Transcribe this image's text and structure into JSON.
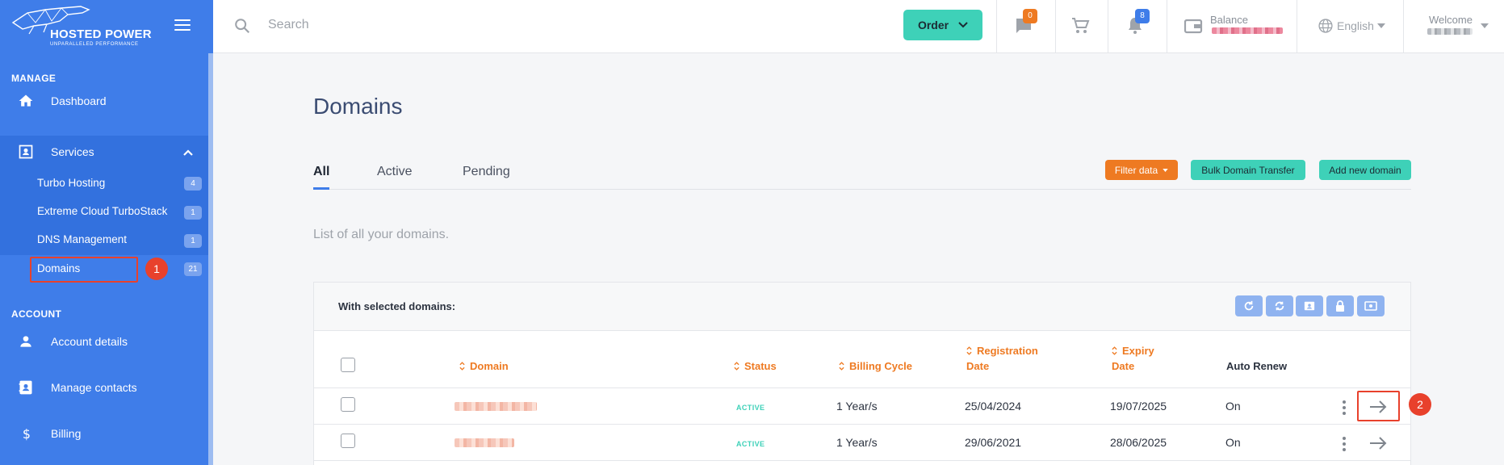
{
  "brand": {
    "name": "HOSTED POWER",
    "tagline": "UNPARALLELED PERFORMANCE"
  },
  "sidebar": {
    "manage_title": "MANAGE",
    "account_title": "ACCOUNT",
    "dashboard": "Dashboard",
    "services": "Services",
    "services_items": [
      {
        "label": "Turbo Hosting",
        "count": "4"
      },
      {
        "label": "Extreme Cloud TurboStack",
        "count": "1"
      },
      {
        "label": "DNS Management",
        "count": "1"
      },
      {
        "label": "Domains",
        "count": "21"
      }
    ],
    "account_details": "Account details",
    "manage_contacts": "Manage contacts",
    "billing": "Billing"
  },
  "annotations": {
    "marker1": "1",
    "marker2": "2"
  },
  "header": {
    "search_placeholder": "Search",
    "order_label": "Order",
    "messages_count": "0",
    "notifications_count": "8",
    "balance_label": "Balance",
    "language": "English",
    "welcome_label": "Welcome"
  },
  "main": {
    "title": "Domains",
    "tabs": [
      "All",
      "Active",
      "Pending"
    ],
    "filter_label": "Filter data",
    "bulk_transfer_label": "Bulk Domain Transfer",
    "add_domain_label": "Add new domain",
    "description": "List of all your domains.",
    "with_selected": "With selected domains:",
    "columns": {
      "domain": "Domain",
      "status": "Status",
      "billing_cycle": "Billing Cycle",
      "registration_line1": "Registration",
      "registration_line2": "Date",
      "expiry_line1": "Expiry",
      "expiry_line2": "Date",
      "auto_renew": "Auto Renew"
    },
    "rows": [
      {
        "status": "ACTIVE",
        "billing": "1 Year/s",
        "registration": "25/04/2024",
        "expiry": "19/07/2025",
        "auto_renew": "On"
      },
      {
        "status": "ACTIVE",
        "billing": "1 Year/s",
        "registration": "29/06/2021",
        "expiry": "28/06/2025",
        "auto_renew": "On"
      }
    ]
  },
  "colors": {
    "sidebar": "#3f7de9",
    "accent_orange": "#ee7a22",
    "accent_teal": "#3ed1b8",
    "marker_red": "#e8412c"
  }
}
